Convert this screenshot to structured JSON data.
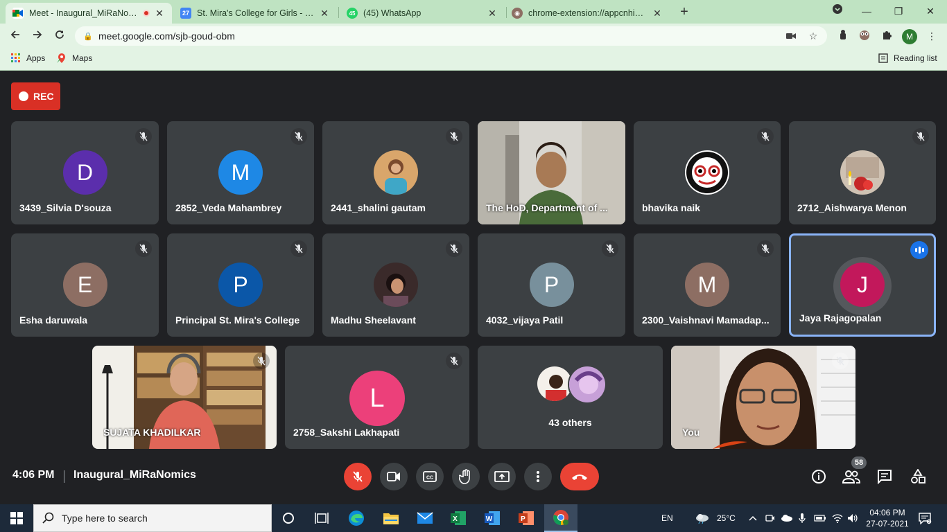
{
  "browser": {
    "tabs": [
      {
        "title": "Meet - Inaugural_MiRaNomics",
        "favicon": "meet-icon",
        "active": true,
        "recording": true
      },
      {
        "title": "St. Mira's College for Girls - Calendar",
        "favicon": "calendar-icon",
        "favicon_text": "27",
        "active": false
      },
      {
        "title": "(45) WhatsApp",
        "favicon": "whatsapp-icon",
        "favicon_text": "45",
        "active": false
      },
      {
        "title": "chrome-extension://appcnhiefcidclcdjeahgklghghihfok",
        "favicon": "extension-owl-icon",
        "active": false
      }
    ],
    "new_tab_label": "+",
    "url": "meet.google.com/sjb-goud-obm",
    "profile_initial": "M",
    "bookmarks": [
      {
        "label": "Apps",
        "icon": "apps-grid-icon"
      },
      {
        "label": "Maps",
        "icon": "maps-icon"
      }
    ],
    "reading_list_label": "Reading list",
    "theme_color": "#bfe3c2"
  },
  "meet": {
    "rec_label": "REC",
    "participants_row1": [
      {
        "name": "3439_Silvia D'souza",
        "initial": "D",
        "color": "#5b2eac",
        "muted": true
      },
      {
        "name": "2852_Veda Mahambrey",
        "initial": "M",
        "color": "#1e88e5",
        "muted": true
      },
      {
        "name": "2441_shalini gautam",
        "photo": "profile-photo",
        "muted": true
      },
      {
        "name": "The HoD, Department of ...",
        "video": true,
        "muted": false
      },
      {
        "name": "bhavika naik",
        "photo": "jagannath-profile-photo",
        "muted": true
      },
      {
        "name": "2712_Aishwarya Menon",
        "photo": "candle-profile-photo",
        "muted": true
      }
    ],
    "participants_row2": [
      {
        "name": "Esha daruwala",
        "initial": "E",
        "color": "#8d6e63",
        "muted": true
      },
      {
        "name": "Principal St. Mira's College",
        "initial": "P",
        "color": "#0b57a8",
        "muted": true
      },
      {
        "name": "Madhu Sheelavant",
        "photo": "profile-photo",
        "muted": true
      },
      {
        "name": "4032_vijaya Patil",
        "initial": "P",
        "color": "#78909c",
        "muted": true
      },
      {
        "name": "2300_Vaishnavi Mamadap...",
        "initial": "M",
        "color": "#8d6e63",
        "muted": true
      },
      {
        "name": "Jaya Rajagopalan",
        "initial": "J",
        "color": "#c2185b",
        "speaking": true
      }
    ],
    "participants_row3": [
      {
        "name": "SUJATA KHADILKAR",
        "video": true,
        "muted": true
      },
      {
        "name": "2758_Sakshi Lakhapati",
        "initial": "L",
        "color": "#ec407a",
        "muted": true
      },
      {
        "name": "43 others",
        "others": true
      },
      {
        "name": "You",
        "video": true,
        "muted": true
      }
    ],
    "time": "4:06 PM",
    "meeting_name": "Inaugural_MiRaNomics",
    "participant_count": "58"
  },
  "taskbar": {
    "search_placeholder": "Type here to search",
    "language": "EN",
    "weather": "25°C",
    "time": "04:06 PM",
    "date": "27-07-2021"
  }
}
